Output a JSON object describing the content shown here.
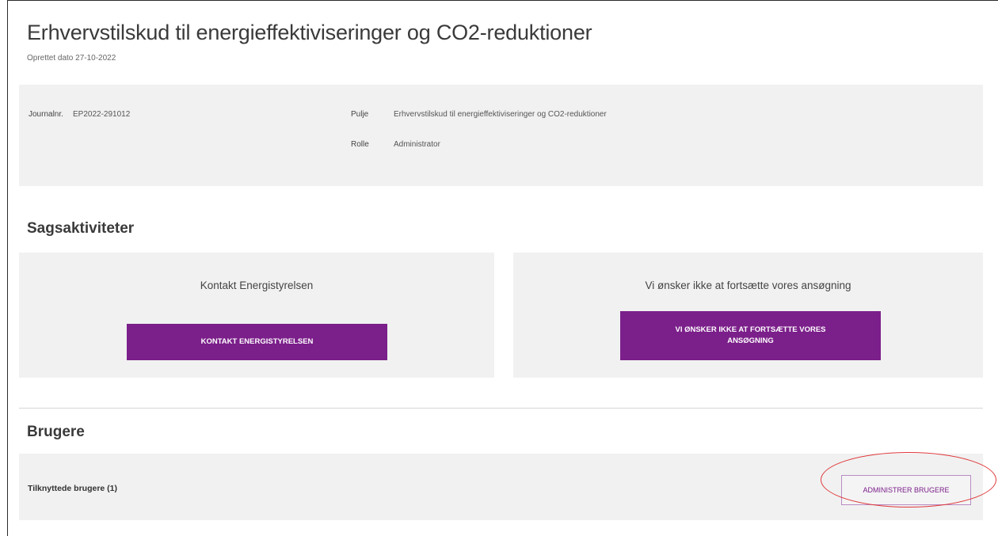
{
  "page": {
    "title": "Erhvervstilskud til energieffektiviseringer og CO2-reduktioner",
    "created": "Oprettet dato 27-10-2022"
  },
  "info": {
    "journal_label": "Journalnr.",
    "journal_value": "EP2022-291012",
    "pulje_label": "Pulje",
    "pulje_value": "Erhvervstilskud til energieffektiviseringer og CO2-reduktioner",
    "rolle_label": "Rolle",
    "rolle_value": "Administrator"
  },
  "activities": {
    "heading": "Sagsaktiviteter",
    "contact": {
      "text": "Kontakt Energistyrelsen",
      "button": "KONTAKT ENERGISTYRELSEN"
    },
    "withdraw": {
      "text": "Vi ønsker ikke at fortsætte vores ansøgning",
      "button": "VI ØNSKER IKKE AT FORTSÆTTE VORES ANSØGNING"
    }
  },
  "users": {
    "heading": "Brugere",
    "linked_label": "Tilknyttede brugere (1)",
    "admin_button": "ADMINISTRER BRUGERE"
  },
  "colors": {
    "accent": "#7b1f8a",
    "panel": "#f1f1f1",
    "highlight": "#e0383a"
  }
}
